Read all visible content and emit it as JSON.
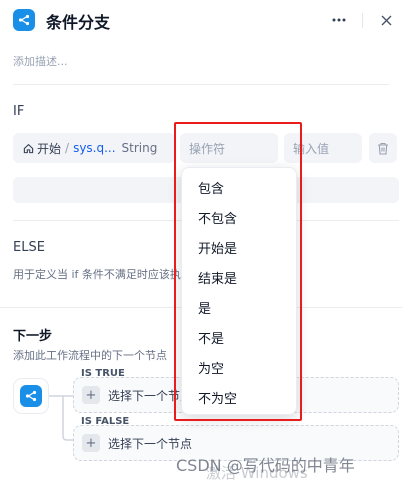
{
  "header": {
    "title": "条件分支",
    "description_placeholder": "添加描述...",
    "more_icon": "more-horizontal-icon",
    "close_icon": "close-icon",
    "accent": "#1a8fe8"
  },
  "if_section": {
    "label": "IF",
    "variable": {
      "node": "开始",
      "name": "sys.q...",
      "type": "String"
    },
    "operator_placeholder": "操作符",
    "value_placeholder": "输入值"
  },
  "else_section": {
    "label": "ELSE",
    "description": "用于定义当 if 条件不满足时应该执行的逻辑。"
  },
  "next_step": {
    "title": "下一步",
    "description": "添加此工作流程中的下一个节点",
    "branches": [
      {
        "label": "IS TRUE",
        "action": "选择下一个节点"
      },
      {
        "label": "IS FALSE",
        "action": "选择下一个节点"
      }
    ]
  },
  "operator_dropdown": {
    "options": [
      "包含",
      "不包含",
      "开始是",
      "结束是",
      "是",
      "不是",
      "为空",
      "不为空"
    ],
    "highlight_color": "#e81c1c"
  },
  "watermarks": {
    "csdn": "CSDN @写代码的中青年",
    "windows": "激活 Windows"
  }
}
